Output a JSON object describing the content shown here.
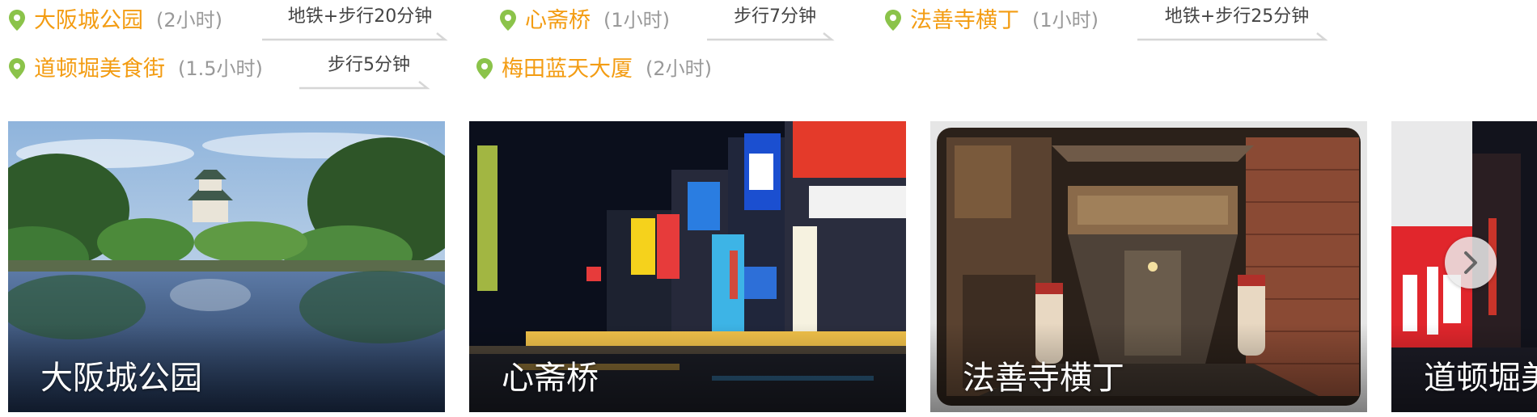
{
  "route": {
    "stops": [
      {
        "name": "大阪城公园",
        "duration": "(2小时)"
      },
      {
        "name": "心斋桥",
        "duration": "(1小时)"
      },
      {
        "name": "法善寺横丁",
        "duration": "(1小时)"
      },
      {
        "name": "道顿堀美食街",
        "duration": "(1.5小时)"
      },
      {
        "name": "梅田蓝天大厦",
        "duration": "(2小时)"
      }
    ],
    "transports": [
      {
        "label": "地铁+步行20分钟"
      },
      {
        "label": "步行7分钟"
      },
      {
        "label": "地铁+步行25分钟"
      },
      {
        "label": "步行5分钟"
      }
    ],
    "icons": {
      "stop_marker": "location-pin-icon",
      "transport_connector": "arrow-line-icon"
    }
  },
  "carousel": {
    "cards": [
      {
        "caption": "大阪城公园"
      },
      {
        "caption": "心斋桥"
      },
      {
        "caption": "法善寺横丁"
      },
      {
        "caption": "道顿堀美"
      }
    ],
    "next_button_icon": "chevron-right-icon"
  },
  "colors": {
    "stop_name": "#f39c12",
    "pin": "#8bc34a",
    "duration": "#999999",
    "transport_text": "#444444",
    "caption": "#ffffff"
  }
}
